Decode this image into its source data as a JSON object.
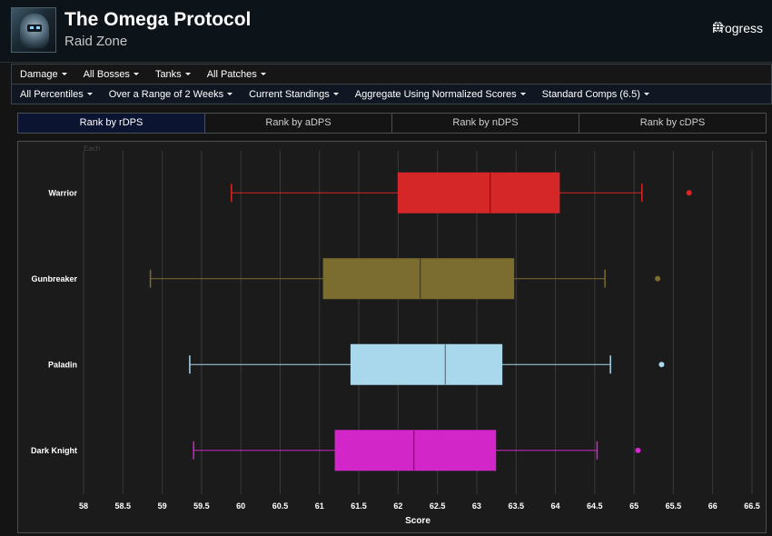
{
  "header": {
    "title": "The Omega Protocol",
    "subtitle": "Raid Zone",
    "progress_label": "Progress"
  },
  "filters_row1": [
    {
      "label": "Damage"
    },
    {
      "label": "All Bosses"
    },
    {
      "label": "Tanks"
    },
    {
      "label": "All Patches"
    }
  ],
  "filters_row2": [
    {
      "label": "All Percentiles"
    },
    {
      "label": "Over a Range of 2 Weeks"
    },
    {
      "label": "Current Standings"
    },
    {
      "label": "Aggregate Using Normalized Scores"
    },
    {
      "label": "Standard Comps (6.5)"
    }
  ],
  "tabs": [
    {
      "label": "Rank by rDPS",
      "active": true
    },
    {
      "label": "Rank by aDPS",
      "active": false
    },
    {
      "label": "Rank by nDPS",
      "active": false
    },
    {
      "label": "Rank by cDPS",
      "active": false
    }
  ],
  "chart_data": {
    "type": "boxplot",
    "orientation": "horizontal",
    "corner_label": "Each",
    "xlabel": "Score",
    "xlim": [
      58,
      66.5
    ],
    "xticks": [
      "58",
      "58.5",
      "59",
      "59.5",
      "60",
      "60.5",
      "61",
      "61.5",
      "62",
      "62.5",
      "63",
      "63.5",
      "64",
      "64.5",
      "65",
      "65.5",
      "66",
      "66.5"
    ],
    "grid": true,
    "series": [
      {
        "name": "Warrior",
        "color": "#d62728",
        "min": 59.88,
        "q1": 62.0,
        "median": 63.17,
        "q3": 64.05,
        "max": 65.1,
        "outliers": [
          65.7
        ]
      },
      {
        "name": "Gunbreaker",
        "color": "#7b6c2f",
        "min": 58.85,
        "q1": 61.05,
        "median": 62.28,
        "q3": 63.47,
        "max": 64.63,
        "outliers": [
          65.3
        ]
      },
      {
        "name": "Paladin",
        "color": "#a9d7ec",
        "min": 59.35,
        "q1": 61.4,
        "median": 62.6,
        "q3": 63.32,
        "max": 64.7,
        "outliers": [
          65.35
        ]
      },
      {
        "name": "Dark Knight",
        "color": "#d226c9",
        "min": 59.4,
        "q1": 61.2,
        "median": 62.2,
        "q3": 63.24,
        "max": 64.53,
        "outliers": [
          65.05
        ]
      }
    ]
  },
  "colors": {
    "background": "#141414",
    "header_bg": "#0d1419",
    "active_tab_bg": "#0b1430",
    "chart_bg": "#1b1b1b",
    "grid": "#3a3a3a"
  }
}
